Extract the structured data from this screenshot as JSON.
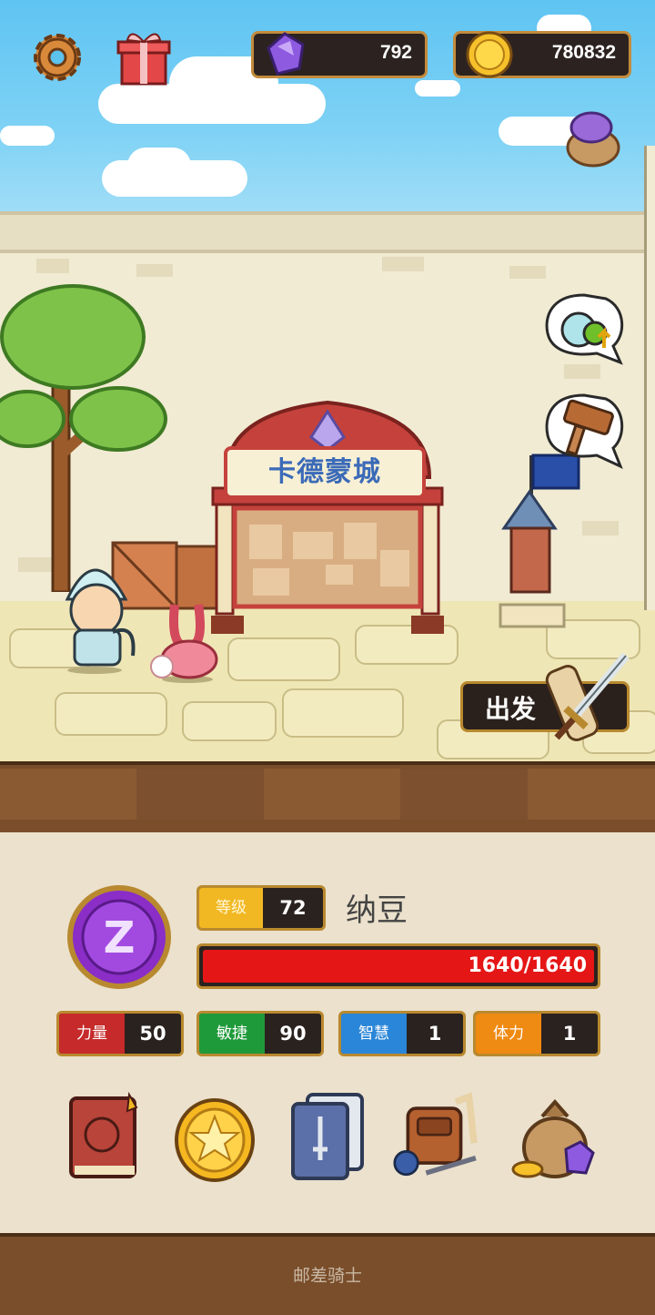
{
  "header": {
    "gem_count": "792",
    "gold_count": "780832",
    "icons": [
      "gear-icon",
      "gift-box-icon",
      "purple-gem-icon",
      "gold-coin-icon",
      "gem-sack-icon"
    ]
  },
  "town": {
    "sign_text": "卡德蒙城",
    "depart_label": "出发",
    "side_icons": [
      "potion-upgrade-icon",
      "hammer-icon"
    ]
  },
  "character": {
    "level_label": "等级",
    "level": "72",
    "name": "纳豆",
    "hp_text": "1640/1640",
    "hp_fraction": 1.0,
    "stats": [
      {
        "label": "力量",
        "value": "50",
        "color": "#c62a2a"
      },
      {
        "label": "敏捷",
        "value": "90",
        "color": "#1f9a3a"
      },
      {
        "label": "智慧",
        "value": "1",
        "color": "#2a86d8"
      },
      {
        "label": "体力",
        "value": "1",
        "color": "#ef8a12"
      }
    ]
  },
  "menu": [
    "hero-book-icon",
    "star-coin-icon",
    "skill-cards-icon",
    "equipment-bag-icon",
    "treasure-sack-icon"
  ],
  "footer": "邮差骑士",
  "colors": {
    "sky": "#6ccaf4",
    "hp_red": "#e51616",
    "frame_gold": "#b9892f",
    "level_yellow": "#f2b823"
  }
}
